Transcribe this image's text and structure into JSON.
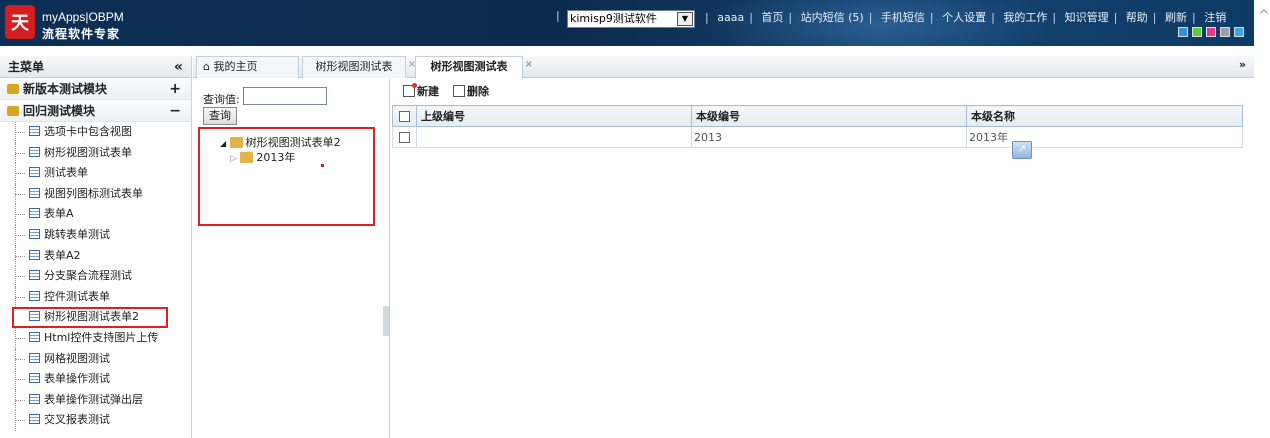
{
  "header": {
    "logo_mark": "天",
    "logo_line1": "myApps|OBPM",
    "logo_line2": "流程软件专家",
    "select_value": "kimisp9测试软件",
    "links": [
      "aaaa",
      "首页",
      "站内短信 (5)",
      "手机短信",
      "个人设置",
      "我的工作",
      "知识管理",
      "帮助",
      "刷新",
      "注销"
    ],
    "theme_colors": [
      "#3b8fd8",
      "#5ecb3c",
      "#e83a8f",
      "#9aa0a6",
      "#3fa6e6"
    ]
  },
  "sidebar": {
    "title": "主菜单",
    "modules": [
      {
        "label": "新版本测试模块",
        "toggle": "+"
      },
      {
        "label": "回归测试模块",
        "toggle": "−"
      }
    ],
    "items": [
      "选项卡中包含视图",
      "树形视图测试表单",
      "测试表单",
      "视图列图标测试表单",
      "表单A",
      "跳转表单测试",
      "表单A2",
      "分支聚合流程测试",
      "控件测试表单",
      "树形视图测试表单2",
      "Html控件支持图片上传",
      "网格视图测试",
      "表单操作测试",
      "表单操作测试弹出层",
      "交叉报表测试"
    ]
  },
  "tabs": [
    {
      "label": "我的主页"
    },
    {
      "label": "树形视图测试表"
    },
    {
      "label": "树形视图测试表"
    }
  ],
  "tree": {
    "query_label": "查询值:",
    "query_button": "查询",
    "root": "树形视图测试表单2",
    "child": "2013年"
  },
  "toolbar": {
    "new_label": "新建",
    "delete_label": "删除"
  },
  "grid": {
    "columns": [
      "上级编号",
      "本级编号",
      "本级名称"
    ],
    "rows": [
      [
        "",
        "2013",
        "2013年"
      ]
    ]
  }
}
